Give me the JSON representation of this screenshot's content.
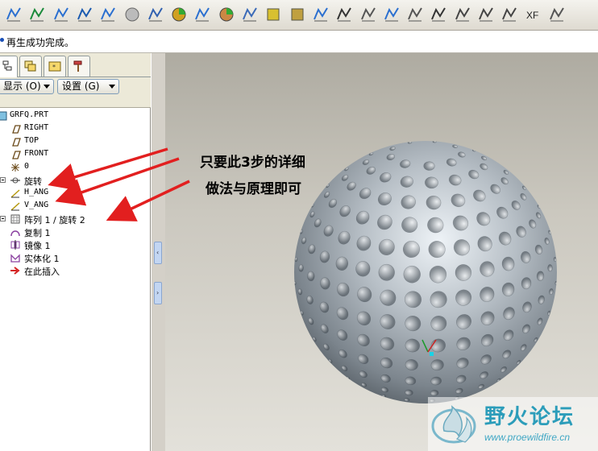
{
  "toolbar": {
    "icons": [
      "sketch-datum-icon",
      "curve-icon",
      "wave-curve-icon",
      "spline-icon",
      "crossing-curve-icon",
      "shaded-view-icon",
      "measure-icon",
      "color-spectrum-icon",
      "surface-curve-icon",
      "render-color-icon",
      "offset-icon",
      "box-icon",
      "layers-icon",
      "histogram-icon",
      "draft-icon",
      "k-stamp-icon",
      "spring-icon",
      "scale-icon",
      "table-icon",
      "section-icon",
      "triangle-icon",
      "dimension-icon",
      "xf-icon",
      "stack-icon"
    ]
  },
  "status": {
    "message": "再生成功完成。"
  },
  "panel": {
    "tabs": [
      "model-tree-tab",
      "layers-tab",
      "favorites-tab",
      "tools-tab"
    ],
    "show_button": "显示 (O)",
    "settings_button": "设置 (G)"
  },
  "tree": [
    {
      "label": "GRFQ.PRT",
      "icon": "part-icon",
      "expandable": false,
      "cjk": false
    },
    {
      "label": "RIGHT",
      "icon": "datum-plane-icon",
      "expandable": false,
      "cjk": false
    },
    {
      "label": "TOP",
      "icon": "datum-plane-icon",
      "expandable": false,
      "cjk": false
    },
    {
      "label": "FRONT",
      "icon": "datum-plane-icon",
      "expandable": false,
      "cjk": false
    },
    {
      "label": "0",
      "icon": "coordinate-system-icon",
      "expandable": false,
      "cjk": false
    },
    {
      "label": "旋转",
      "icon": "revolve-icon",
      "expandable": true,
      "cjk": true
    },
    {
      "label": "H_ANG",
      "icon": "parameter-icon",
      "expandable": false,
      "cjk": false
    },
    {
      "label": "V_ANG",
      "icon": "parameter-icon",
      "expandable": false,
      "cjk": false
    },
    {
      "label": "阵列 1 / 旋转 2",
      "icon": "pattern-icon",
      "expandable": true,
      "cjk": true
    },
    {
      "label": "复制 1",
      "icon": "copy-icon",
      "expandable": false,
      "cjk": true
    },
    {
      "label": "镜像 1",
      "icon": "mirror-icon",
      "expandable": false,
      "cjk": true
    },
    {
      "label": "实体化 1",
      "icon": "solidify-icon",
      "expandable": false,
      "cjk": true
    },
    {
      "label": "在此插入",
      "icon": "insert-here-icon",
      "expandable": false,
      "cjk": true
    }
  ],
  "annotation": {
    "line1": "只要此3步的详细",
    "line2": "做法与原理即可",
    "color": "#e21f1f"
  },
  "watermark": {
    "title": "野火论坛",
    "url": "www.proewildfire.cn",
    "color": "#2c9dba"
  }
}
